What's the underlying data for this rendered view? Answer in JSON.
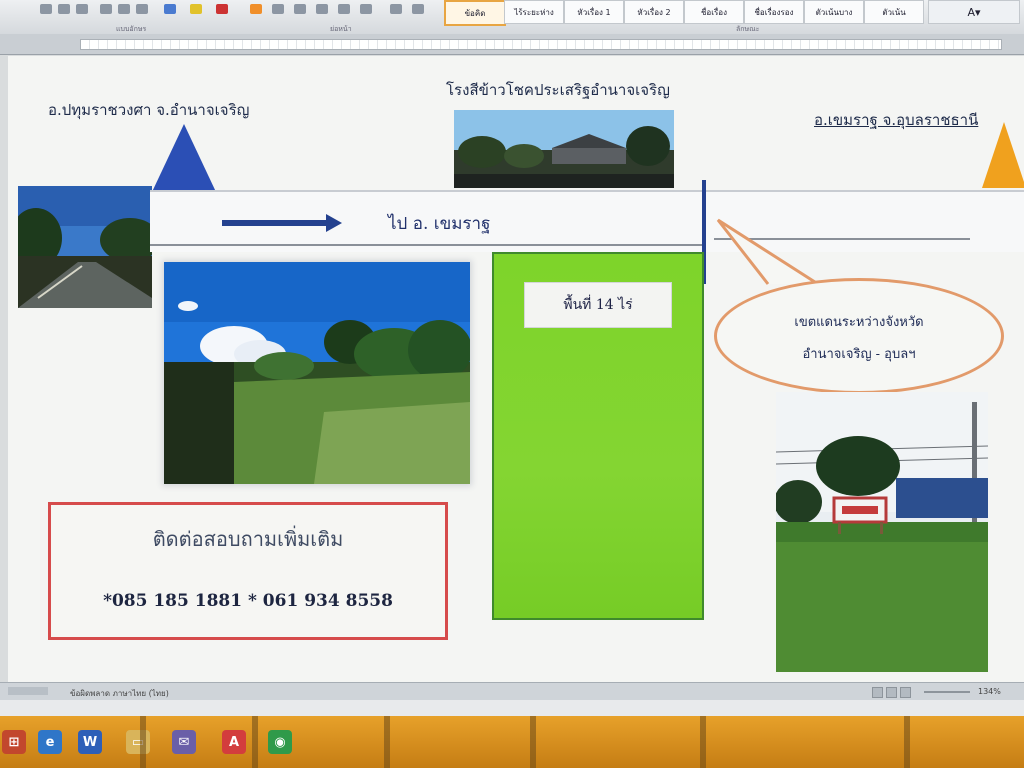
{
  "app": {
    "ribbon": {
      "style_gallery": [
        "ข้อคิด",
        "ไร้ระยะห่าง",
        "หัวเรื่อง 1",
        "หัวเรื่อง 2",
        "ชื่อเรื่อง",
        "ชื่อเรื่องรอง",
        "ตัวเน้นบาง",
        "ตัวเน้น"
      ],
      "group_labels": [
        "แบบอักษร",
        "ย่อหน้า",
        "ลักษณะ"
      ]
    },
    "status": {
      "left_text": "ข้อผิดพลาด ภาษาไทย (ไทย)",
      "zoom": "134%"
    },
    "taskbar": {
      "items": [
        "windows-start",
        "ie",
        "word",
        "folder",
        "mail",
        "adobe",
        "chrome"
      ]
    }
  },
  "document": {
    "heading_left": "อ.ปทุมราชวงศา จ.อำนาจเจริญ",
    "heading_center": "โรงสีข้าวโชคประเสริฐอำนาจเจริญ",
    "heading_right": "อ.เขมราฐ จ.อุบลราชธานี",
    "road_label": "ไป อ. เขมราฐ",
    "area_label": "พื้นที่ 14 ไร่",
    "bubble_line1": "เขตแดนระหว่างจังหวัด",
    "bubble_line2": "อำนาจเจริญ - อุบลฯ",
    "contact_title": "ติดต่อสอบถามเพิ่มเติม",
    "contact_phones": "*085 185 1881  * 061 934  8558"
  },
  "colors": {
    "accent_blue": "#2b4fb5",
    "accent_orange": "#f0a11e",
    "land_green": "#7ed42a",
    "contact_border": "#d64b4b",
    "bubble_border": "#e29a6a",
    "taskbar": "#e7a12a"
  }
}
